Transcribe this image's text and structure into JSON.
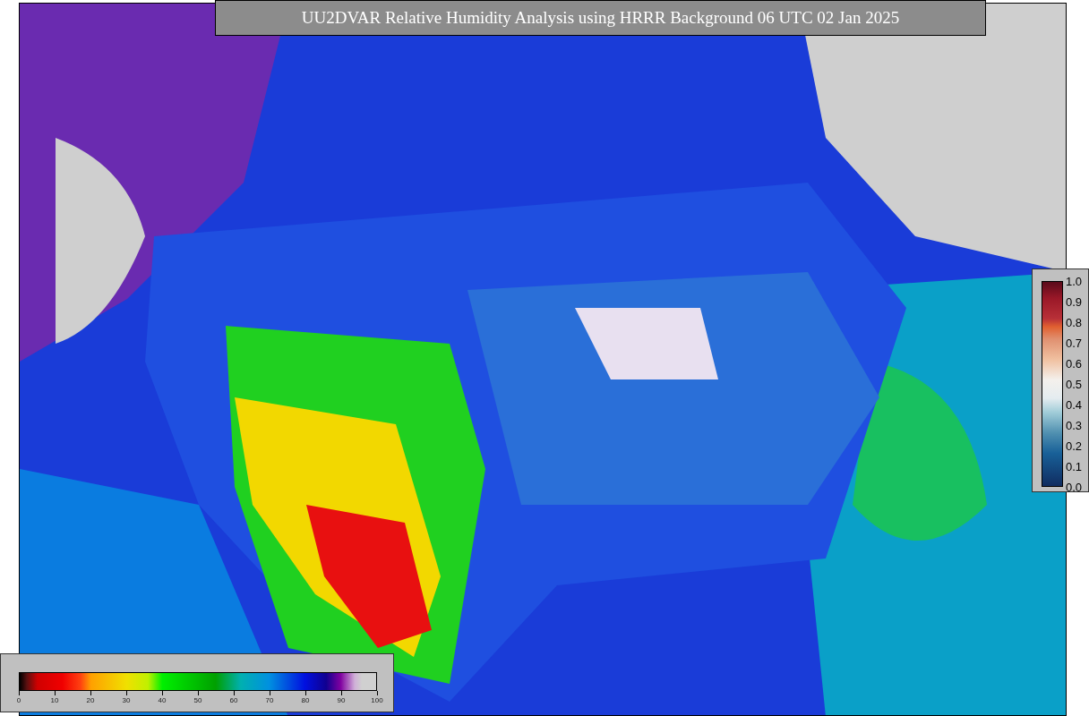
{
  "title": "UU2DVAR Relative Humidity Analysis using HRRR Background 06 UTC 02 Jan 2025",
  "humidity_scale": {
    "ticks": [
      "0",
      "10",
      "20",
      "30",
      "40",
      "50",
      "60",
      "70",
      "80",
      "90",
      "100"
    ]
  },
  "observation_scale": {
    "ticks": [
      "1.0",
      "0.9",
      "0.8",
      "0.7",
      "0.6",
      "0.5",
      "0.4",
      "0.3",
      "0.2",
      "0.1",
      "0.0"
    ]
  }
}
